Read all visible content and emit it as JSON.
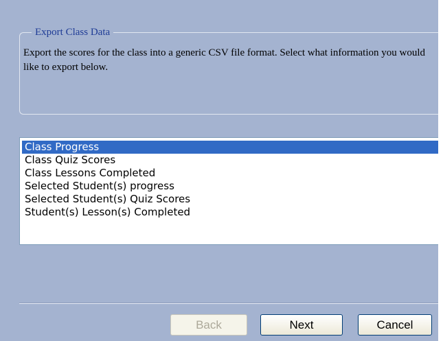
{
  "export_group": {
    "title": "Export Class Data",
    "description": "Export the scores for the class into a generic CSV file format. Select what information you would like to export below."
  },
  "export_options": {
    "selected_index": 0,
    "items": [
      {
        "label": "Class Progress",
        "selected": true
      },
      {
        "label": "Class Quiz Scores",
        "selected": false
      },
      {
        "label": "Class Lessons Completed",
        "selected": false
      },
      {
        "label": "Selected Student(s) progress",
        "selected": false
      },
      {
        "label": "Selected Student(s) Quiz Scores",
        "selected": false
      },
      {
        "label": "Student(s) Lesson(s) Completed",
        "selected": false
      }
    ]
  },
  "buttons": {
    "back": {
      "label": "Back",
      "enabled": false
    },
    "next": {
      "label": "Next",
      "enabled": true
    },
    "cancel": {
      "label": "Cancel",
      "enabled": true
    }
  },
  "colors": {
    "background": "#a4b3d0",
    "title_text": "#1f3c96",
    "selection": "#316ac5"
  }
}
